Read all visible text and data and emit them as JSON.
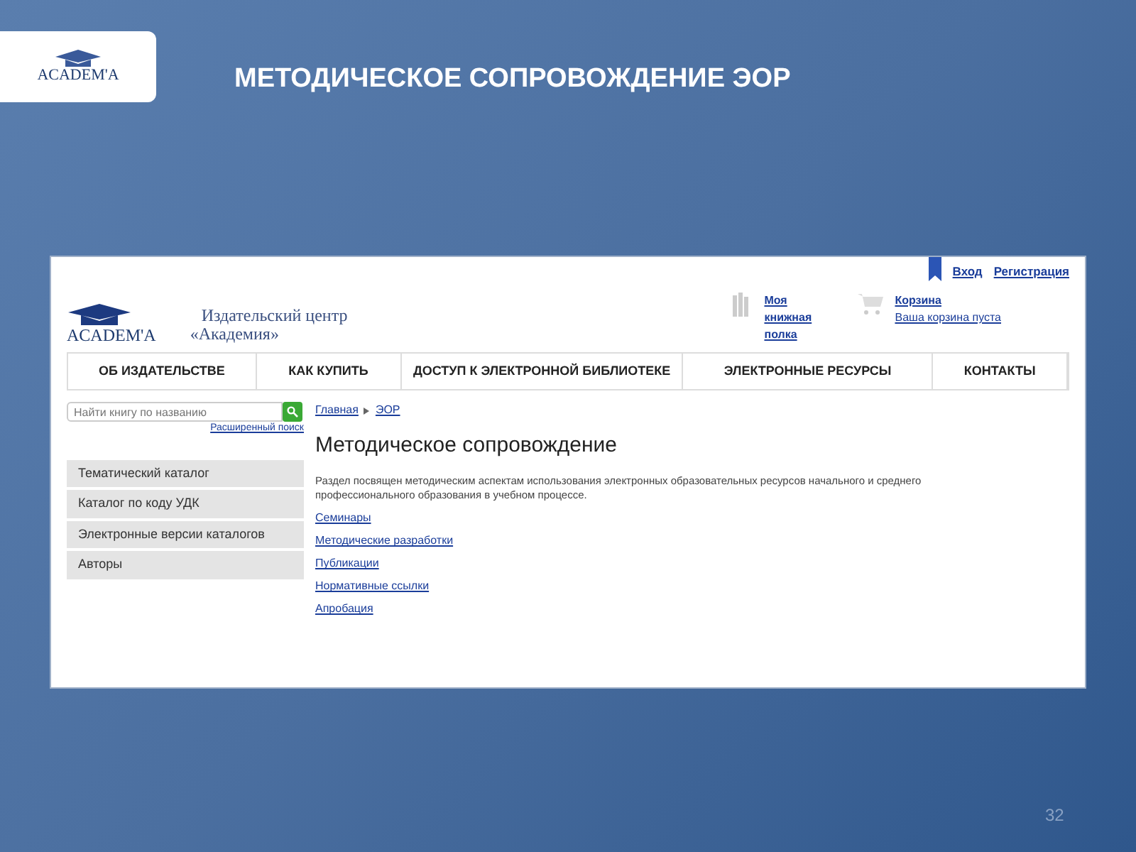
{
  "slide": {
    "title": "МЕТОДИЧЕСКОЕ СОПРОВОЖДЕНИЕ ЭОР",
    "logo_text": "ACADEM'A",
    "number": "32"
  },
  "site": {
    "logo_text": "ACADEM'A",
    "publisher_line_1": "Издательский центр",
    "publisher_line_2": "«Академия»",
    "auth_links": [
      "Вход",
      "Регистрация"
    ],
    "shelf_link": "Моя книжная полка",
    "cart_link": "Корзина",
    "cart_status": "Ваша корзина пуста",
    "nav": [
      {
        "label": "ОБ ИЗДАТЕЛЬСТВЕ"
      },
      {
        "label": "КАК КУПИТЬ"
      },
      {
        "label": "ДОСТУП К ЭЛЕКТРОННОЙ БИБЛИОТЕКЕ"
      },
      {
        "label": "ЭЛЕКТРОННЫЕ РЕСУРСЫ"
      },
      {
        "label": "КОНТАКТЫ"
      }
    ],
    "search": {
      "placeholder": "Найти книгу по названию",
      "advanced_link": "Расширенный поиск"
    },
    "sidebar": {
      "items": [
        {
          "label": "Тематический каталог"
        },
        {
          "label": "Каталог по коду УДК"
        },
        {
          "label": "Электронные версии каталогов"
        },
        {
          "label": "Авторы"
        }
      ]
    },
    "breadcrumb": [
      "Главная",
      "ЭОР"
    ],
    "heading": "Методическое сопровождение",
    "description": "Раздел посвящен методическим аспектам использования электронных образовательных ресурсов начального и среднего профессионального образования в учебном процессе.",
    "links": [
      "Семинары",
      "Методические разработки",
      "Публикации",
      "Нормативные ссылки",
      "Апробация"
    ]
  }
}
